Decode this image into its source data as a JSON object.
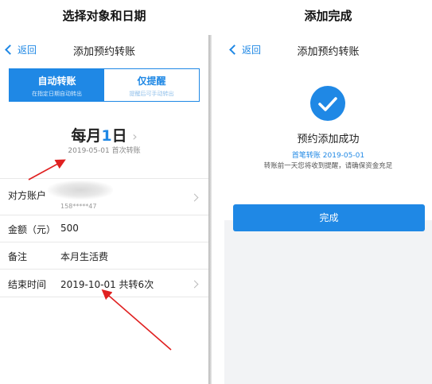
{
  "captions": {
    "left": "选择对象和日期",
    "right": "添加完成"
  },
  "left_screen": {
    "nav": {
      "back_label": "返回",
      "title": "添加预约转账"
    },
    "segments": [
      {
        "label": "自动转账",
        "sub": "在指定日期自动转出",
        "active": true
      },
      {
        "label": "仅提醒",
        "sub": "提醒后可手动转出",
        "active": false
      }
    ],
    "date": {
      "prefix": "每月",
      "day": "1",
      "suffix": "日",
      "first_transfer": "2019-05-01 首次转账"
    },
    "rows": {
      "account": {
        "label": "对方账户",
        "number": "158*****47"
      },
      "amount": {
        "label": "金额（元）",
        "value": "500"
      },
      "note": {
        "label": "备注",
        "value": "本月生活费"
      },
      "end": {
        "label": "结束时间",
        "value": "2019-10-01 共转6次"
      }
    }
  },
  "right_screen": {
    "nav": {
      "back_label": "返回",
      "title": "添加预约转账"
    },
    "success_title": "预约添加成功",
    "first_transfer": "首笔转账 2019-05-01",
    "note": "转账前一天您将收到提醒，请确保资金充足",
    "done_label": "完成"
  },
  "colors": {
    "accent": "#1f88e5",
    "annotation": "#e02020"
  }
}
